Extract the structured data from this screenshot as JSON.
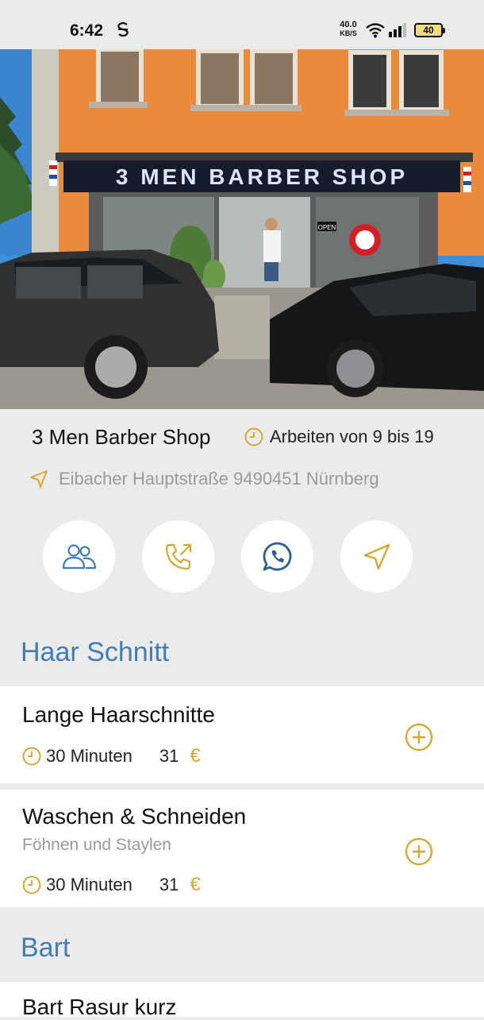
{
  "status_bar": {
    "time": "6:42",
    "speed_value": "40.0",
    "speed_unit": "KB/S",
    "battery": "40"
  },
  "shop": {
    "name": "3 Men Barber Shop",
    "hours": "Arbeiten von 9 bis 19",
    "address": "Eibacher Hauptstraße 9490451 Nürnberg",
    "sign_text": "3 MEN BARBER SHOP",
    "open_sign": "OPEN",
    "icons": {
      "hours": "clock-icon",
      "address": "navigation-arrow-icon"
    }
  },
  "actions": [
    {
      "name": "team-button",
      "icon": "people-icon"
    },
    {
      "name": "call-button",
      "icon": "phone-outgoing-icon"
    },
    {
      "name": "whatsapp-button",
      "icon": "whatsapp-icon"
    },
    {
      "name": "navigate-button",
      "icon": "navigation-arrow-icon"
    }
  ],
  "sections": [
    {
      "title": "Haar Schnitt",
      "services": [
        {
          "name": "Lange Haarschnitte",
          "subtitle": "",
          "duration": "30 Minuten",
          "price": "31",
          "currency": "€"
        },
        {
          "name": "Waschen & Schneiden",
          "subtitle": "Föhnen und Staylen",
          "duration": "30 Minuten",
          "price": "31",
          "currency": "€"
        }
      ]
    },
    {
      "title": "Bart",
      "services": [
        {
          "name": "Bart Rasur kurz"
        }
      ]
    }
  ],
  "colors": {
    "accent_blue": "#3f7db4",
    "gold": "#d4a838",
    "background": "#ebebeb",
    "card": "#ffffff"
  }
}
